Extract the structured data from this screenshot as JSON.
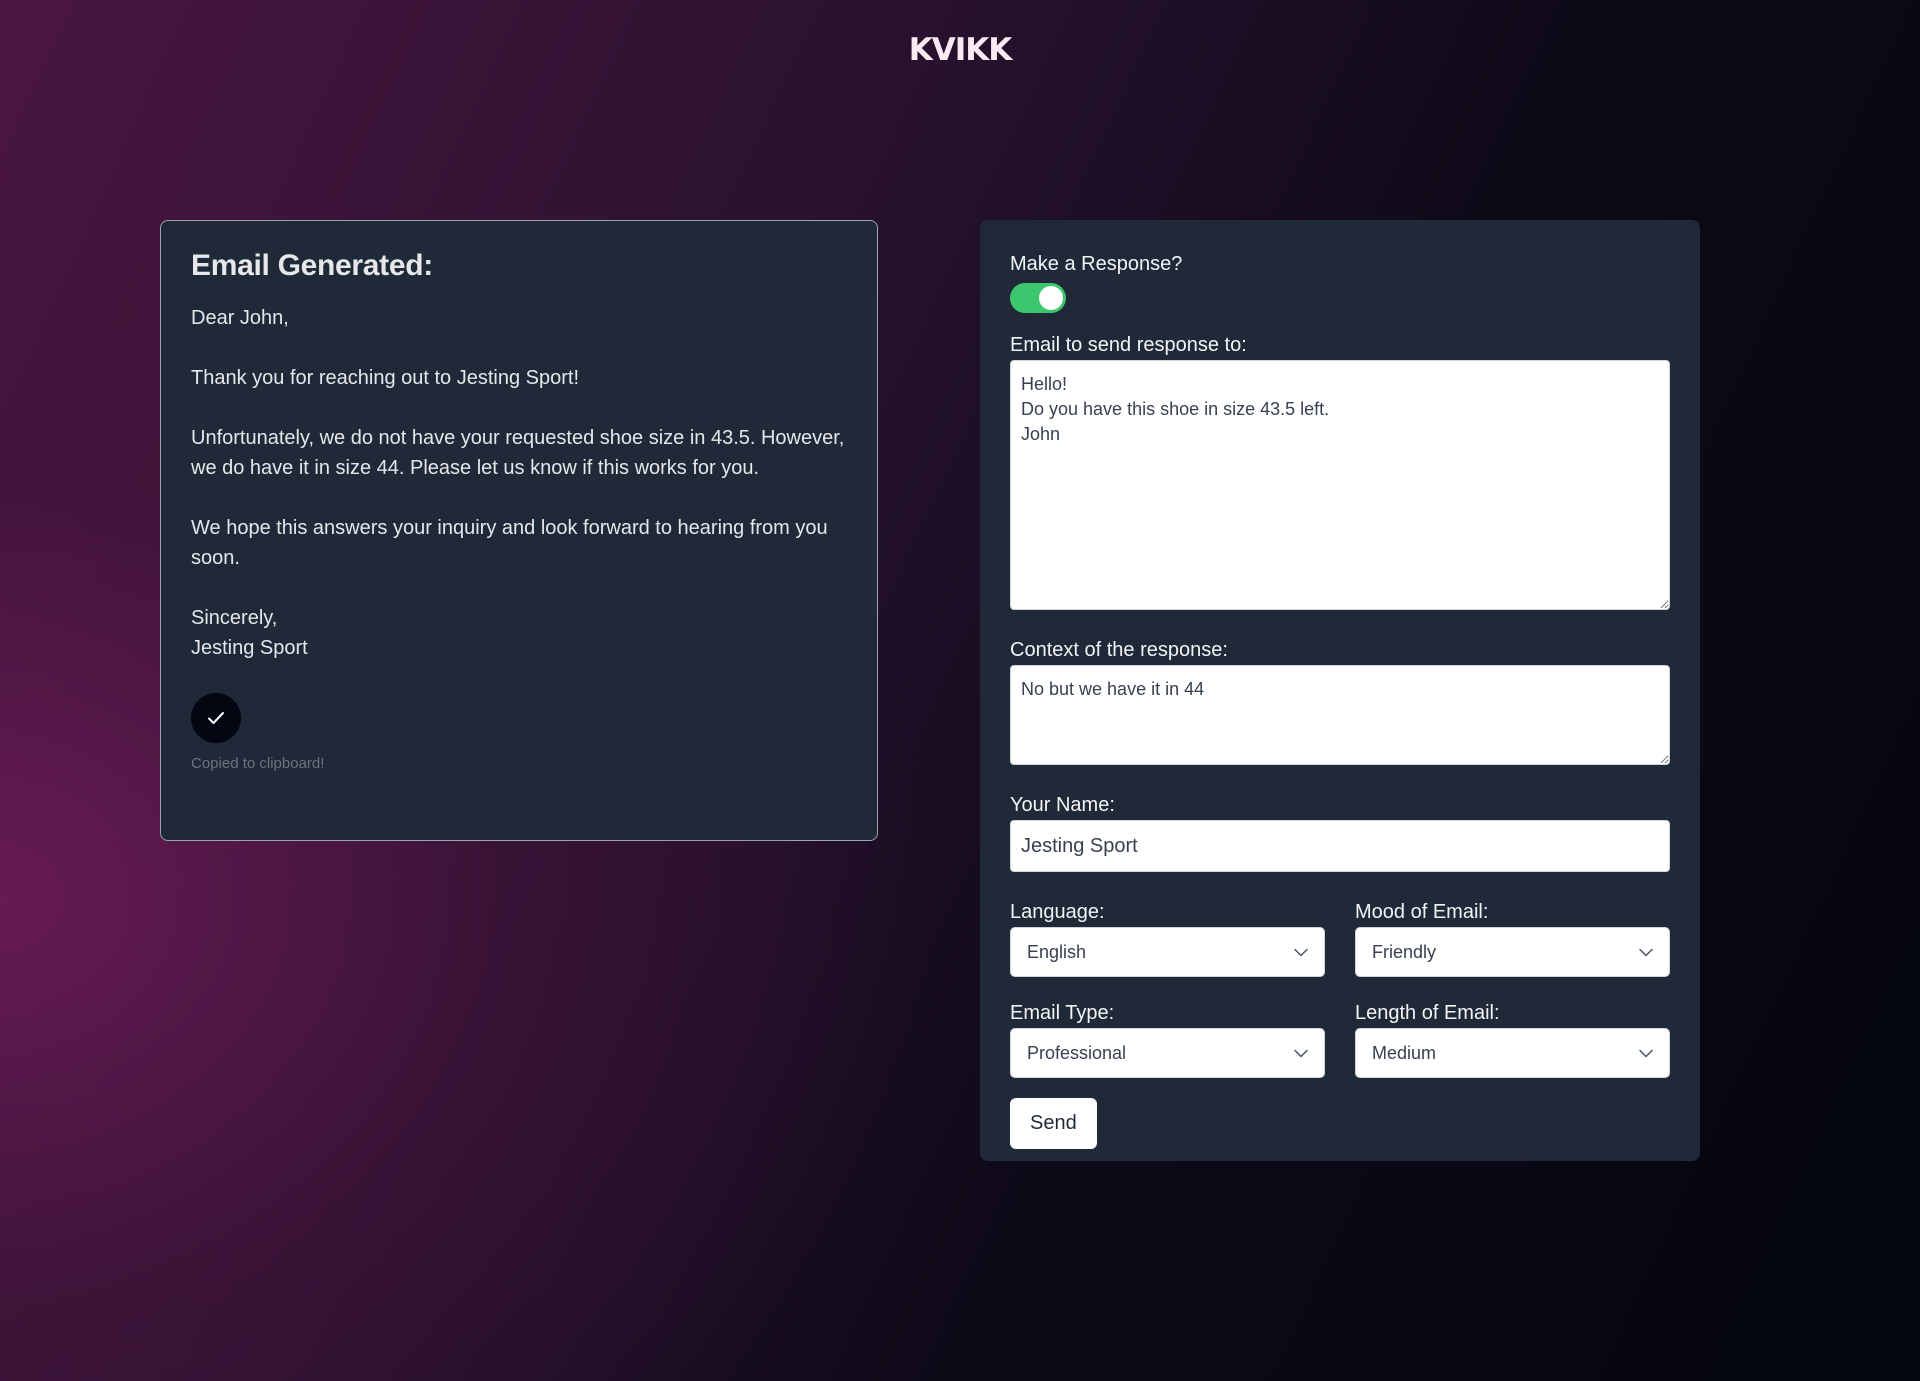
{
  "header": {
    "logo_text": "KVIKK"
  },
  "output": {
    "title": "Email Generated:",
    "paragraphs": [
      "Dear John,",
      "Thank you for reaching out to Jesting Sport!",
      "Unfortunately, we do not have your requested shoe size in 43.5. However, we do have it in size 44. Please let us know if this works for you.",
      "We hope this answers your inquiry and look forward to hearing from you soon.",
      "Sincerely,\nJesting Sport"
    ],
    "copy_icon": "check-icon",
    "copied_text": "Copied to clipboard!"
  },
  "form": {
    "make_response_label": "Make a Response?",
    "make_response_on": true,
    "email_label": "Email to send response to:",
    "email_value": "Hello!\nDo you have this shoe in size 43.5 left.\nJohn",
    "context_label": "Context of the response:",
    "context_value": "No but we have it in 44",
    "name_label": "Your Name:",
    "name_value": "Jesting Sport",
    "language_label": "Language:",
    "language_value": "English",
    "mood_label": "Mood of Email:",
    "mood_value": "Friendly",
    "type_label": "Email Type:",
    "type_value": "Professional",
    "length_label": "Length of Email:",
    "length_value": "Medium",
    "send_label": "Send"
  },
  "colors": {
    "panel": "#1f2937",
    "toggle_on": "#3cc76e",
    "accent_bg_dark": "#03060f",
    "accent_bg_magenta": "#6e1c58"
  }
}
